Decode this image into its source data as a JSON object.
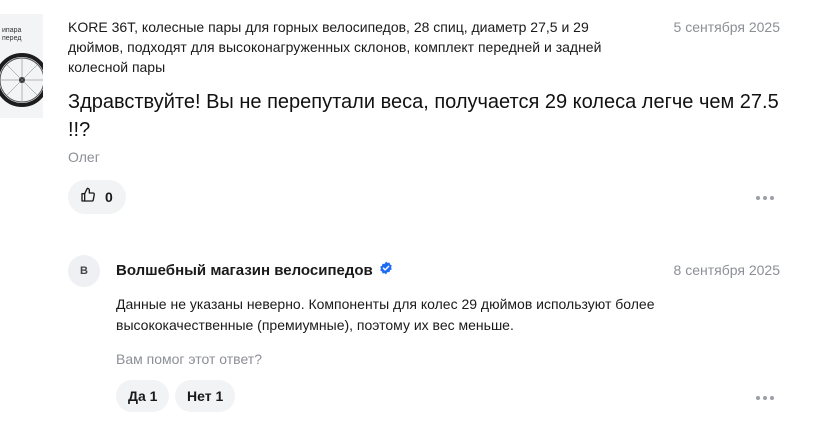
{
  "product": {
    "image_caption_line1": "ипара",
    "image_caption_line2": "перед",
    "title": "KORE 36T, колесные пары для горных велосипедов, 28 спиц, диаметр 27,5 и 29 дюймов, подходят для высоконагруженных склонов, комплект передней и задней колесной пары"
  },
  "question": {
    "date": "5 сентября 2025",
    "text": "Здравствуйте! Вы не перепутали веса, получается 29 колеса легче чем 27.5 !!?",
    "author": "Олег",
    "like_count": "0"
  },
  "answer": {
    "avatar_letter": "В",
    "shop_name": "Волшебный магазин велосипедов",
    "date": "8 сентября 2025",
    "text": "Данные не указаны неверно. Компоненты для колес 29 дюймов используют более высококачественные (премиумные), поэтому их вес меньше.",
    "helpful_prompt": "Вам помог этот ответ?",
    "yes_label": "Да 1",
    "no_label": "Нет 1"
  },
  "icons": {
    "like": "thumbs-up-icon",
    "more": "more-dots-icon",
    "verified": "verified-check-icon"
  },
  "colors": {
    "verified": "#1e6bf5",
    "muted_text": "#8c8f96",
    "button_bg": "#f2f3f5"
  }
}
